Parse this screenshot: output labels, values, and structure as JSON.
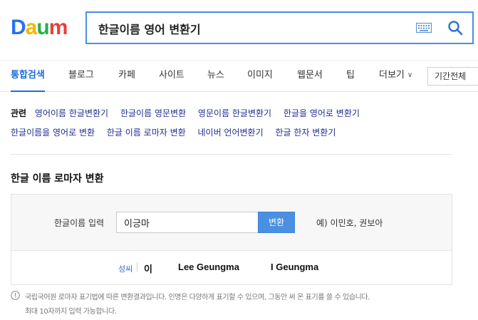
{
  "header": {
    "logo": {
      "letters": [
        "D",
        "a",
        "u",
        "m"
      ]
    },
    "search": {
      "value": "한글이름 영어 변환기"
    }
  },
  "tabs": [
    {
      "label": "통합검색",
      "active": true
    },
    {
      "label": "블로그"
    },
    {
      "label": "카페"
    },
    {
      "label": "사이트"
    },
    {
      "label": "뉴스"
    },
    {
      "label": "이미지"
    },
    {
      "label": "웹문서"
    },
    {
      "label": "팁"
    },
    {
      "label": "더보기"
    }
  ],
  "period_select": {
    "value": "기간전체"
  },
  "related": {
    "label": "관련",
    "row1": [
      "영어이름 한글변환기",
      "한글이름 영문변환",
      "영문이름 한글변환기",
      "한글을 영어로 변환기"
    ],
    "row2": [
      "한글이름을 영어로 변환",
      "한글 이름 로마자 변환",
      "네이버 언어변환기",
      "한글 한자 변환기"
    ]
  },
  "converter": {
    "title": "한글 이름 로마자 변환",
    "input_label": "한글이름 입력",
    "input_value": "이긍마",
    "button_label": "변환",
    "example": "예) 이민호, 권보아",
    "result": {
      "label": "성씨",
      "hangul": "이",
      "romanized_1": "Lee Geungma",
      "romanized_2": "I Geungma"
    }
  },
  "notice": {
    "line1": "국립국어원 로마자 표기법에 따른 변환결과입니다. 인명은 다양하게 표기할 수 있으며, 그동안 써 온 표기를 쓸 수 있습니다.",
    "line2": "최대 10자까지 입력 가능합니다."
  },
  "colors": {
    "accent": "#1a6ed8",
    "button": "#4a90e2",
    "link": "#1d2f8f"
  }
}
